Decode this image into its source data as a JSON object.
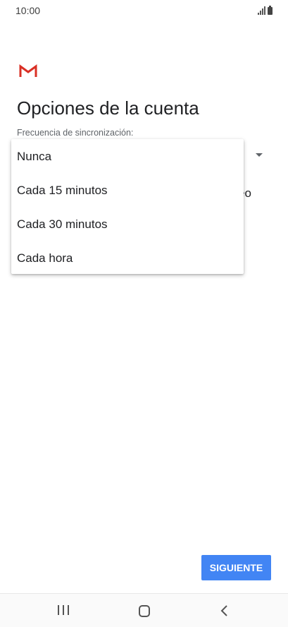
{
  "status_bar": {
    "time": "10:00"
  },
  "header": {
    "logo_icon": "gmail-logo",
    "title": "Opciones de la cuenta"
  },
  "sync_field": {
    "label": "Frecuencia de sincronización:",
    "partially_hidden_text": "eo"
  },
  "dropdown": {
    "options": [
      "Nunca",
      "Cada 15 minutos",
      "Cada 30 minutos",
      "Cada hora"
    ]
  },
  "actions": {
    "next_label": "SIGUIENTE",
    "next_color": "#4285f4"
  },
  "nav_bar": {
    "icons": [
      "recents-icon",
      "home-icon",
      "back-icon"
    ]
  }
}
